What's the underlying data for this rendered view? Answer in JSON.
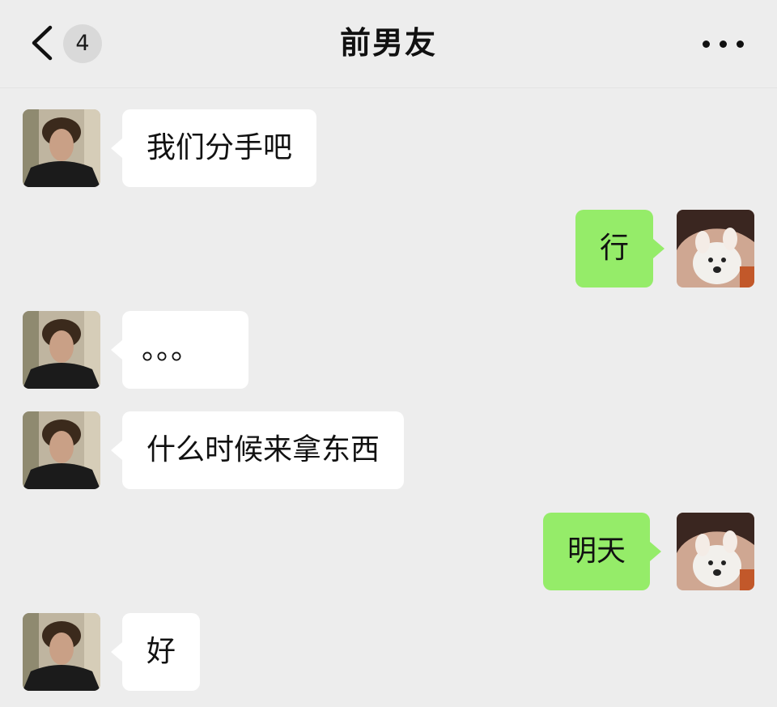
{
  "header": {
    "unread_count": "4",
    "title": "前男友"
  },
  "messages": [
    {
      "side": "left",
      "text": "我们分手吧",
      "avatar": "boyfriend-avatar"
    },
    {
      "side": "right",
      "text": "行",
      "avatar": "my-avatar-dog"
    },
    {
      "side": "left",
      "text": "。。。",
      "avatar": "boyfriend-avatar"
    },
    {
      "side": "left",
      "text": "什么时候来拿东西",
      "avatar": "boyfriend-avatar"
    },
    {
      "side": "right",
      "text": "明天",
      "avatar": "my-avatar-dog"
    },
    {
      "side": "left",
      "text": "好",
      "avatar": "boyfriend-avatar"
    }
  ],
  "colors": {
    "background": "#ededed",
    "incoming_bubble": "#ffffff",
    "outgoing_bubble": "#95ec69"
  },
  "icons": {
    "back": "chevron-left-icon",
    "more": "more-dots-icon"
  }
}
